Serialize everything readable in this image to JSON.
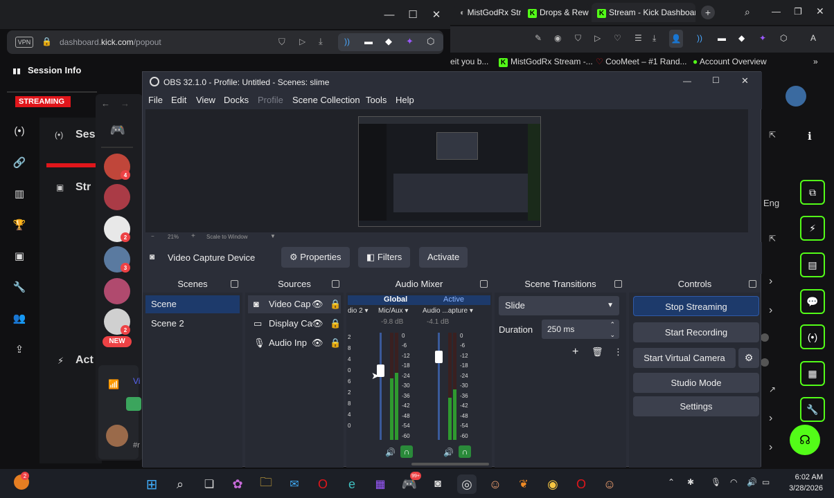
{
  "popout": {
    "vpn": "VPN",
    "url_prefix": "dashboard.",
    "url_domain": "kick.com",
    "url_suffix": "/popout",
    "session_title": "Session Info",
    "status": "STREAMING",
    "card_ses": "Ses",
    "card_str": "Str",
    "card_act": "Act",
    "card_vi": "Vi",
    "card_r": "#r",
    "new_badge": "NEW",
    "badges": [
      "4",
      "2",
      "3",
      "2"
    ]
  },
  "browser": {
    "tabs": [
      "MistGodRx Str",
      "Drops & Rewa",
      "Stream - Kick Dashboard"
    ],
    "bookmarks": [
      "eit you b...",
      "MistGodRx Stream -...",
      "CooMeet – #1 Rand...",
      "Account Overview"
    ],
    "eng_label": "Eng"
  },
  "obs": {
    "title": "OBS 32.1.0 - Profile: Untitled - Scenes: slime",
    "menu": [
      "File",
      "Edit",
      "View",
      "Docks",
      "Profile",
      "Scene Collection",
      "Tools",
      "Help"
    ],
    "zoom": "21%",
    "scale_mode": "Scale to Window",
    "source_name": "Video Capture Device",
    "properties_label": "Properties",
    "filters_label": "Filters",
    "activate_label": "Activate",
    "docks": {
      "scenes": "Scenes",
      "sources": "Sources",
      "audio_mixer": "Audio Mixer",
      "transitions": "Scene Transitions",
      "controls": "Controls"
    },
    "scenes": [
      "Scene",
      "Scene 2"
    ],
    "sources": [
      "Video Cap",
      "Display Ca",
      "Audio Inp"
    ],
    "mixer": {
      "global_label": "Global",
      "active_label": "Active",
      "channels": [
        {
          "name": "dio 2",
          "db": ""
        },
        {
          "name": "Mic/Aux",
          "db": "-9.8 dB"
        },
        {
          "name": "Audio ...apture",
          "db": "-4.1 dB"
        }
      ],
      "ticks": [
        "0",
        "-6",
        "-12",
        "-18",
        "-24",
        "-30",
        "-36",
        "-42",
        "-48",
        "-54",
        "-60"
      ],
      "left_ticks": [
        "2",
        "8",
        "4",
        "0",
        "6",
        "2",
        "8",
        "4",
        "0"
      ]
    },
    "transition": "Slide",
    "duration_label": "Duration",
    "duration_value": "250 ms",
    "controls": [
      "Stop Streaming",
      "Start Recording",
      "Start Virtual Camera",
      "Studio Mode",
      "Settings"
    ]
  },
  "taskbar": {
    "time": "6:02 AM",
    "date": "3/28/2026",
    "notif_count": "2",
    "discord_count": "99+"
  }
}
